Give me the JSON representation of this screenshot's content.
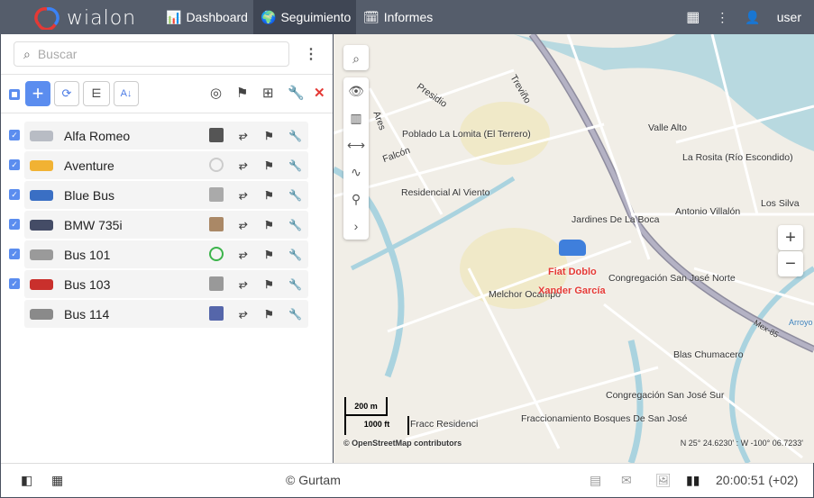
{
  "header": {
    "logo": "wialon",
    "nav": [
      {
        "label": "Dashboard",
        "icon": "bar-chart-icon"
      },
      {
        "label": "Seguimiento",
        "icon": "globe-icon",
        "active": true
      },
      {
        "label": "Informes",
        "icon": "report-icon"
      }
    ],
    "user": "user"
  },
  "sidebar": {
    "search_placeholder": "Buscar",
    "units": [
      {
        "name": "Alfa Romeo",
        "checked": true,
        "icon_color": "#b8bcc4",
        "driver_color": "#555"
      },
      {
        "name": "Aventure",
        "checked": true,
        "icon_color": "#f1b233",
        "driver": "steering-wheel-grey"
      },
      {
        "name": "Blue Bus",
        "checked": true,
        "icon_color": "#3a6fc4",
        "driver_color": "#aaa"
      },
      {
        "name": "BMW 735i",
        "checked": true,
        "icon_color": "#444c66",
        "driver_color": "#a86"
      },
      {
        "name": "Bus 101",
        "checked": true,
        "icon_color": "#9a9a9a",
        "driver": "steering-wheel-green"
      },
      {
        "name": "Bus 103",
        "checked": true,
        "icon_color": "#c9302c",
        "driver_color": "#999"
      },
      {
        "name": "Bus 114",
        "checked": false,
        "icon_color": "#8a8a8a",
        "driver_color": "#5566aa"
      }
    ]
  },
  "map": {
    "labels": [
      "Presidio",
      "Treviño",
      "Ares",
      "Poblado La Lomita (El Terrero)",
      "Falcón",
      "Valle Alto",
      "La Rosita (Río Escondido)",
      "Residencial Al Viento",
      "Jardines De La Boca",
      "Antonio Villalón",
      "Los Silva",
      "Congregación San José Norte",
      "Melchor Ocampo",
      "Blas Chumacero",
      "Congregación San José Sur",
      "Fraccionamiento Bosques De San José",
      "Fracc Residenci",
      "Mex-85",
      "Arroyo"
    ],
    "unit_label": "Fiat Doblo",
    "driver_label": "Xander García",
    "scale_m": "200 m",
    "scale_ft": "1000 ft",
    "attribution": "© OpenStreetMap contributors",
    "coords": "N 25° 24.6230' : W -100° 06.7233'"
  },
  "footer": {
    "copyright": "© Gurtam",
    "time": "20:00:51 (+02)"
  }
}
